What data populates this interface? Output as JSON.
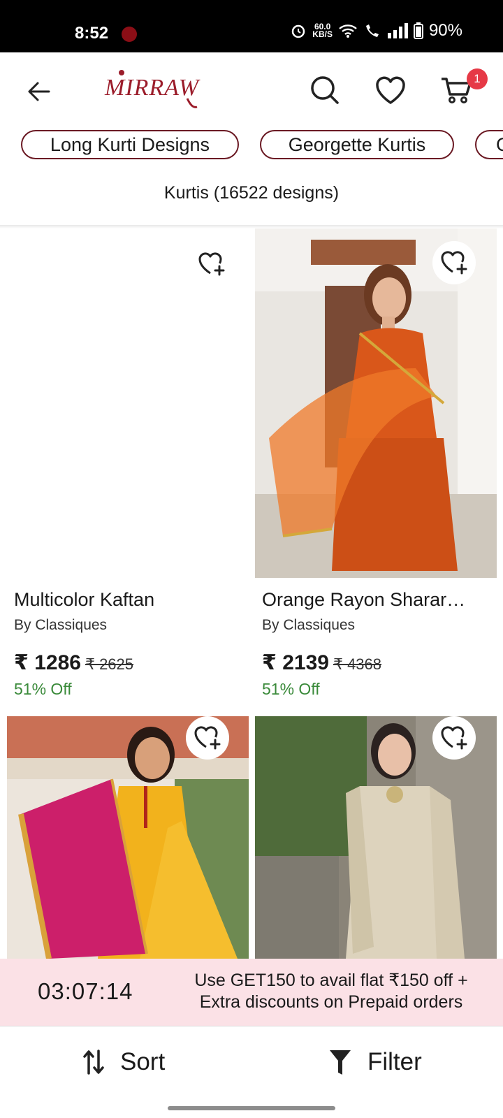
{
  "status": {
    "time": "8:52",
    "net_top": "60.0",
    "net_bottom": "KB/S",
    "battery": "90%"
  },
  "header": {
    "logo": "MIRRAW",
    "cart_count": "1"
  },
  "chips": [
    "Long Kurti Designs",
    "Georgette Kurtis",
    "C"
  ],
  "results": {
    "title": "Kurtis (16522 designs)"
  },
  "products": [
    {
      "title": "Multicolor Kaftan",
      "brand": "By Classiques",
      "price": "₹ 1286",
      "mrp": "₹ 2625",
      "off": "51% Off"
    },
    {
      "title": "Orange Rayon Sharar…",
      "brand": "By Classiques",
      "price": "₹ 2139",
      "mrp": "₹ 4368",
      "off": "51% Off"
    }
  ],
  "promo": {
    "timer": "03:07:14",
    "line1": "Use GET150 to avail flat ₹150 off +",
    "line2": "Extra discounts on Prepaid orders"
  },
  "actions": {
    "sort": "Sort",
    "filter": "Filter"
  },
  "colors": {
    "brand": "#9b1c2a",
    "badge": "#e63946",
    "discount": "#3a8a3a",
    "promo_bg": "#fbe1e6"
  },
  "icons": [
    "back-arrow-icon",
    "search-icon",
    "heart-icon",
    "cart-icon",
    "wishlist-add-icon",
    "sort-icon",
    "filter-icon"
  ]
}
